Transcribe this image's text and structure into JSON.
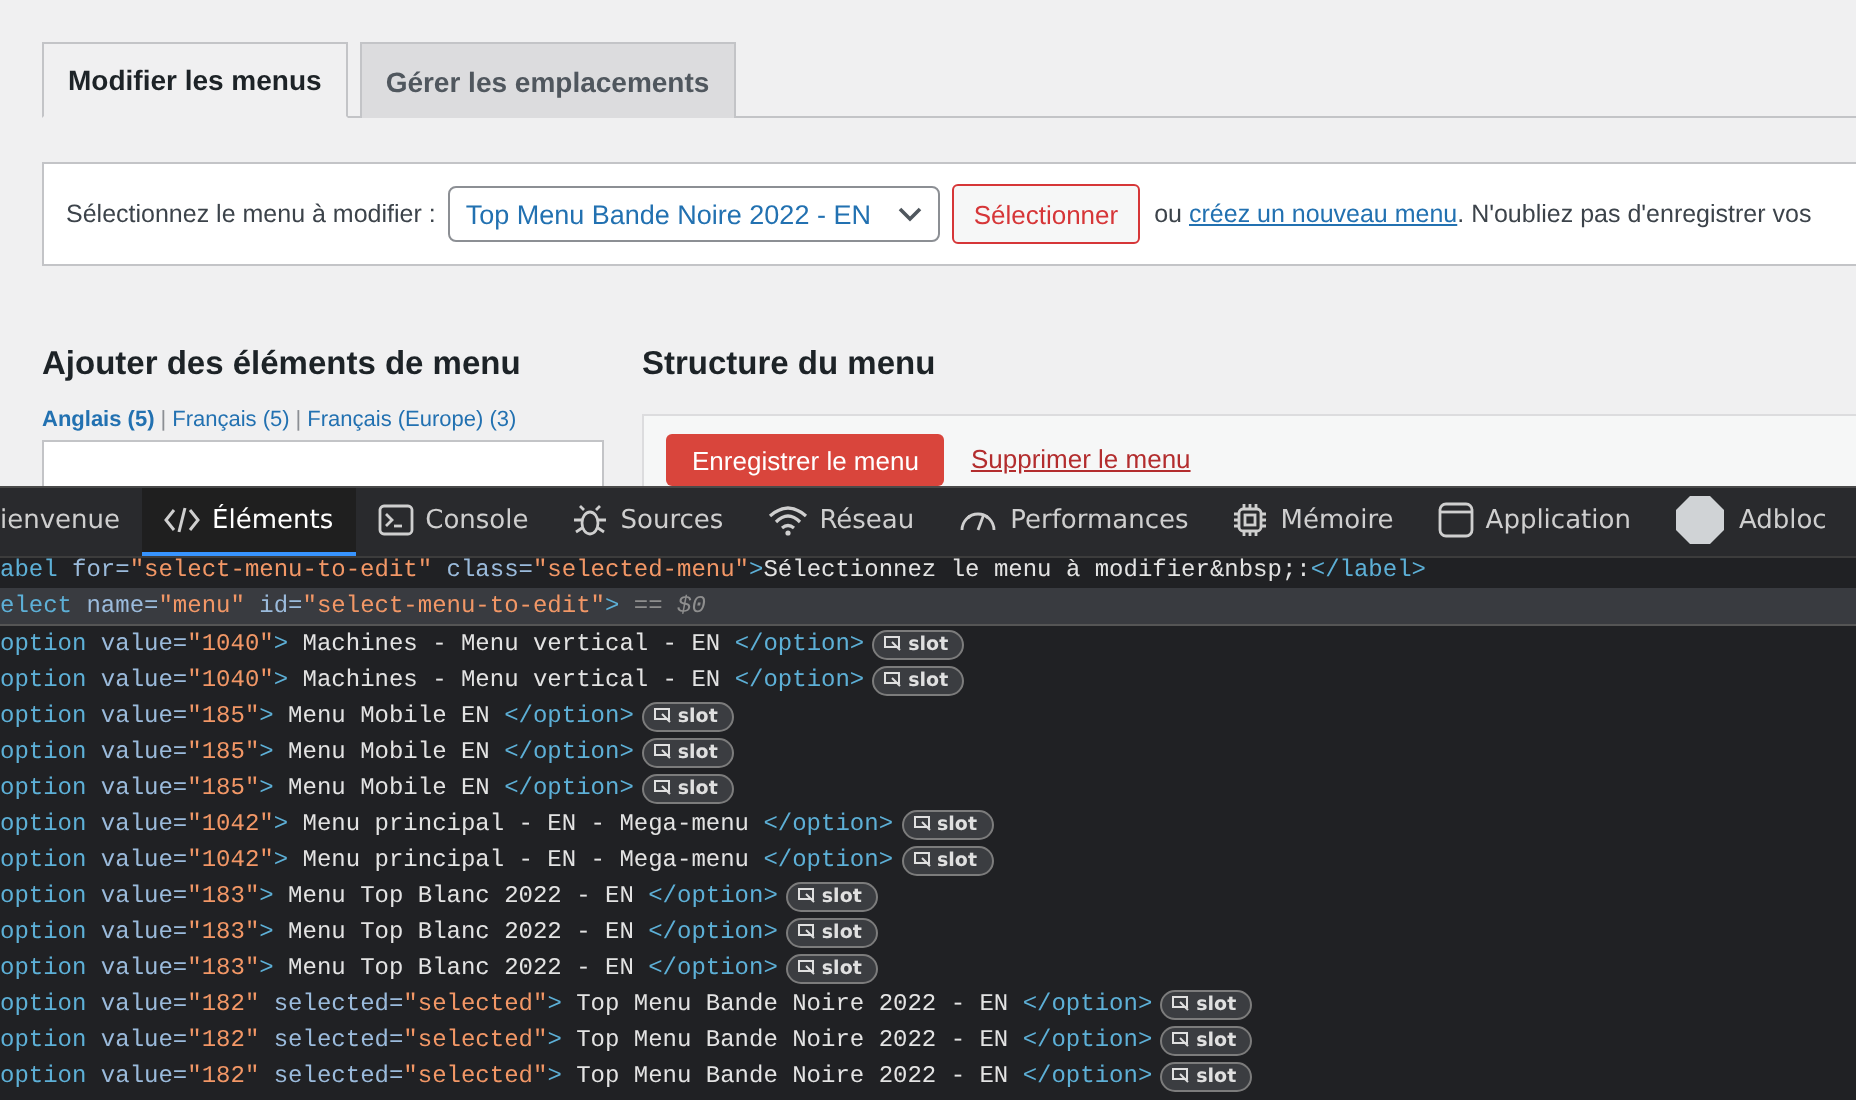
{
  "page_tabs": [
    {
      "label": "Modifier les menus",
      "selected": true
    },
    {
      "label": "Gérer les emplacements",
      "selected": false
    }
  ],
  "menu_picker": {
    "label": "Sélectionnez le menu à modifier :",
    "value": "Top Menu Bande Noire 2022 - EN",
    "button": "Sélectionner",
    "prefix": "ou",
    "link": "créez un nouveau menu",
    "suffix": ". N'oubliez pas d'enregistrer vos"
  },
  "add_items": {
    "heading": "Ajouter des éléments de menu",
    "separator": "|",
    "languages": [
      {
        "label": "Anglais (5)",
        "selected": true
      },
      {
        "label": "Français (5)",
        "selected": false
      },
      {
        "label": "Français (Europe) (3)",
        "selected": false
      }
    ]
  },
  "structure": {
    "heading": "Structure du menu",
    "save_button": "Enregistrer le menu",
    "delete_link": "Supprimer le menu"
  },
  "devtools_tabs": [
    {
      "kind": "welcome",
      "label": "ienvenue",
      "selected": false
    },
    {
      "kind": "elements",
      "label": "Éléments",
      "selected": true
    },
    {
      "kind": "console",
      "label": "Console",
      "selected": false
    },
    {
      "kind": "sources",
      "label": "Sources",
      "selected": false
    },
    {
      "kind": "network",
      "label": "Réseau",
      "selected": false
    },
    {
      "kind": "performance",
      "label": "Performances",
      "selected": false
    },
    {
      "kind": "memory",
      "label": "Mémoire",
      "selected": false
    },
    {
      "kind": "application",
      "label": "Application",
      "selected": false
    },
    {
      "kind": "extension",
      "label": "Adbloc",
      "selected": false
    }
  ],
  "code_lines": [
    {
      "selected": false,
      "tokens": [
        {
          "kind": "tag",
          "text": "abel"
        },
        {
          "kind": "attr",
          "text": " for="
        },
        {
          "kind": "value",
          "text": "\"select-menu-to-edit\""
        },
        {
          "kind": "attr",
          "text": " class="
        },
        {
          "kind": "value",
          "text": "\"selected-menu\""
        },
        {
          "kind": "tag",
          "text": ">"
        },
        {
          "kind": "text",
          "text": "Sélectionnez le menu à modifier&nbsp;:"
        },
        {
          "kind": "tag",
          "text": "</label>"
        }
      ]
    },
    {
      "selected": true,
      "tokens": [
        {
          "kind": "tag",
          "text": "elect"
        },
        {
          "kind": "attr",
          "text": " name="
        },
        {
          "kind": "value",
          "text": "\"menu\""
        },
        {
          "kind": "attr",
          "text": " id="
        },
        {
          "kind": "value",
          "text": "\"select-menu-to-edit\""
        },
        {
          "kind": "tag",
          "text": ">"
        },
        {
          "kind": "comment",
          "text": " == $0"
        }
      ]
    },
    {
      "selected": false,
      "badge": "slot",
      "tokens": [
        {
          "kind": "tag",
          "text": "option"
        },
        {
          "kind": "attr",
          "text": " value="
        },
        {
          "kind": "value",
          "text": "\"1040\""
        },
        {
          "kind": "tag",
          "text": ">"
        },
        {
          "kind": "text",
          "text": " Machines - Menu vertical - EN "
        },
        {
          "kind": "tag",
          "text": "</option>"
        }
      ]
    },
    {
      "selected": false,
      "badge": "slot",
      "tokens": [
        {
          "kind": "tag",
          "text": "option"
        },
        {
          "kind": "attr",
          "text": " value="
        },
        {
          "kind": "value",
          "text": "\"1040\""
        },
        {
          "kind": "tag",
          "text": ">"
        },
        {
          "kind": "text",
          "text": " Machines - Menu vertical - EN "
        },
        {
          "kind": "tag",
          "text": "</option>"
        }
      ]
    },
    {
      "selected": false,
      "badge": "slot",
      "tokens": [
        {
          "kind": "tag",
          "text": "option"
        },
        {
          "kind": "attr",
          "text": " value="
        },
        {
          "kind": "value",
          "text": "\"185\""
        },
        {
          "kind": "tag",
          "text": ">"
        },
        {
          "kind": "text",
          "text": " Menu Mobile EN "
        },
        {
          "kind": "tag",
          "text": "</option>"
        }
      ]
    },
    {
      "selected": false,
      "badge": "slot",
      "tokens": [
        {
          "kind": "tag",
          "text": "option"
        },
        {
          "kind": "attr",
          "text": " value="
        },
        {
          "kind": "value",
          "text": "\"185\""
        },
        {
          "kind": "tag",
          "text": ">"
        },
        {
          "kind": "text",
          "text": " Menu Mobile EN "
        },
        {
          "kind": "tag",
          "text": "</option>"
        }
      ]
    },
    {
      "selected": false,
      "badge": "slot",
      "tokens": [
        {
          "kind": "tag",
          "text": "option"
        },
        {
          "kind": "attr",
          "text": " value="
        },
        {
          "kind": "value",
          "text": "\"185\""
        },
        {
          "kind": "tag",
          "text": ">"
        },
        {
          "kind": "text",
          "text": " Menu Mobile EN "
        },
        {
          "kind": "tag",
          "text": "</option>"
        }
      ]
    },
    {
      "selected": false,
      "badge": "slot",
      "tokens": [
        {
          "kind": "tag",
          "text": "option"
        },
        {
          "kind": "attr",
          "text": " value="
        },
        {
          "kind": "value",
          "text": "\"1042\""
        },
        {
          "kind": "tag",
          "text": ">"
        },
        {
          "kind": "text",
          "text": " Menu principal - EN - Mega-menu "
        },
        {
          "kind": "tag",
          "text": "</option>"
        }
      ]
    },
    {
      "selected": false,
      "badge": "slot",
      "tokens": [
        {
          "kind": "tag",
          "text": "option"
        },
        {
          "kind": "attr",
          "text": " value="
        },
        {
          "kind": "value",
          "text": "\"1042\""
        },
        {
          "kind": "tag",
          "text": ">"
        },
        {
          "kind": "text",
          "text": " Menu principal - EN - Mega-menu "
        },
        {
          "kind": "tag",
          "text": "</option>"
        }
      ]
    },
    {
      "selected": false,
      "badge": "slot",
      "tokens": [
        {
          "kind": "tag",
          "text": "option"
        },
        {
          "kind": "attr",
          "text": " value="
        },
        {
          "kind": "value",
          "text": "\"183\""
        },
        {
          "kind": "tag",
          "text": ">"
        },
        {
          "kind": "text",
          "text": " Menu Top Blanc 2022 - EN "
        },
        {
          "kind": "tag",
          "text": "</option>"
        }
      ]
    },
    {
      "selected": false,
      "badge": "slot",
      "tokens": [
        {
          "kind": "tag",
          "text": "option"
        },
        {
          "kind": "attr",
          "text": " value="
        },
        {
          "kind": "value",
          "text": "\"183\""
        },
        {
          "kind": "tag",
          "text": ">"
        },
        {
          "kind": "text",
          "text": " Menu Top Blanc 2022 - EN "
        },
        {
          "kind": "tag",
          "text": "</option>"
        }
      ]
    },
    {
      "selected": false,
      "badge": "slot",
      "tokens": [
        {
          "kind": "tag",
          "text": "option"
        },
        {
          "kind": "attr",
          "text": " value="
        },
        {
          "kind": "value",
          "text": "\"183\""
        },
        {
          "kind": "tag",
          "text": ">"
        },
        {
          "kind": "text",
          "text": " Menu Top Blanc 2022 - EN "
        },
        {
          "kind": "tag",
          "text": "</option>"
        }
      ]
    },
    {
      "selected": false,
      "badge": "slot",
      "tokens": [
        {
          "kind": "tag",
          "text": "option"
        },
        {
          "kind": "attr",
          "text": " value="
        },
        {
          "kind": "value",
          "text": "\"182\""
        },
        {
          "kind": "attr",
          "text": " selected="
        },
        {
          "kind": "value",
          "text": "\"selected\""
        },
        {
          "kind": "tag",
          "text": ">"
        },
        {
          "kind": "text",
          "text": " Top Menu Bande Noire 2022 - EN "
        },
        {
          "kind": "tag",
          "text": "</option>"
        }
      ]
    },
    {
      "selected": false,
      "badge": "slot",
      "tokens": [
        {
          "kind": "tag",
          "text": "option"
        },
        {
          "kind": "attr",
          "text": " value="
        },
        {
          "kind": "value",
          "text": "\"182\""
        },
        {
          "kind": "attr",
          "text": " selected="
        },
        {
          "kind": "value",
          "text": "\"selected\""
        },
        {
          "kind": "tag",
          "text": ">"
        },
        {
          "kind": "text",
          "text": " Top Menu Bande Noire 2022 - EN "
        },
        {
          "kind": "tag",
          "text": "</option>"
        }
      ]
    },
    {
      "selected": false,
      "badge": "slot",
      "tokens": [
        {
          "kind": "tag",
          "text": "option"
        },
        {
          "kind": "attr",
          "text": " value="
        },
        {
          "kind": "value",
          "text": "\"182\""
        },
        {
          "kind": "attr",
          "text": " selected="
        },
        {
          "kind": "value",
          "text": "\"selected\""
        },
        {
          "kind": "tag",
          "text": ">"
        },
        {
          "kind": "text",
          "text": " Top Menu Bande Noire 2022 - EN "
        },
        {
          "kind": "tag",
          "text": "</option>"
        }
      ]
    }
  ]
}
